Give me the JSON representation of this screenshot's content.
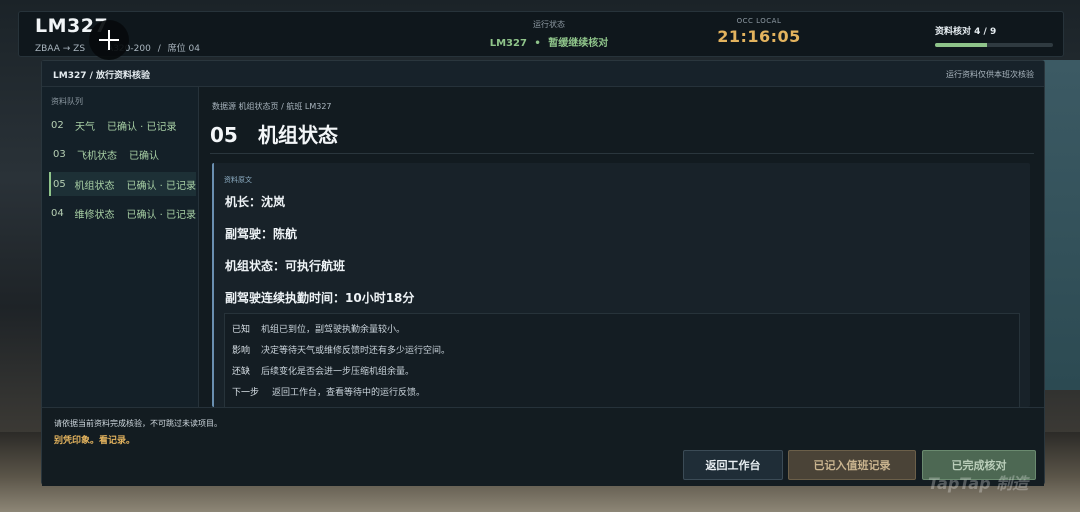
{
  "topbar": {
    "flight_code": "LM327",
    "route": "ZBAA → ZS",
    "route_aircraft": "A320-200",
    "separator": "/",
    "seat": "席位 04",
    "status_label": "运行状态",
    "status_flight": "LM327",
    "status_dot": "•",
    "status_text": "暂缓继续核对",
    "clock_label": "OCC LOCAL",
    "clock_value": "21:16:05",
    "progress_label": "资料核对 4 / 9",
    "progress_fraction": 0.44
  },
  "modal": {
    "title": "LM327 / 放行资料核验",
    "note": "运行资料仅供本班次核验"
  },
  "sidebar": {
    "title": "资料队列",
    "items": [
      {
        "num": "02",
        "label": "天气",
        "state": "已确认 · 已记录",
        "active": false
      },
      {
        "num": "03",
        "label": "飞机状态",
        "state": "已确认",
        "active": false
      },
      {
        "num": "05",
        "label": "机组状态",
        "state": "已确认 · 已记录",
        "active": true
      },
      {
        "num": "04",
        "label": "维修状态",
        "state": "已确认 · 已记录",
        "active": false
      }
    ]
  },
  "main": {
    "breadcrumb": "数据源   机组状态页   /   航班 LM327",
    "title_num": "05",
    "title_text": "机组状态",
    "record_label": "资料原文",
    "record_lines": [
      "机长：沈岚",
      "副驾驶：陈航",
      "机组状态：可执行航班",
      "副驾驶连续执勤时间：10小时18分"
    ],
    "analysis": [
      {
        "k": "已知",
        "v": "机组已到位，副驾驶执勤余量较小。"
      },
      {
        "k": "影响",
        "v": "决定等待天气或维修反馈时还有多少运行空间。"
      },
      {
        "k": "还缺",
        "v": "后续变化是否会进一步压缩机组余量。"
      },
      {
        "k": "下一步",
        "v": "返回工作台，查看等待中的运行反馈。"
      }
    ]
  },
  "footer": {
    "hint": "请依据当前资料完成核验，不可跳过未读项目。",
    "motto": "别凭印象。看记录。",
    "btn_back": "返回工作台",
    "btn_logged": "已记入值班记录",
    "btn_done": "已完成核对"
  },
  "watermark": "TapTap 制造",
  "colors": {
    "accent_green": "#8fc48a",
    "accent_amber": "#e3b35e",
    "panel_bg": "#121b20"
  }
}
